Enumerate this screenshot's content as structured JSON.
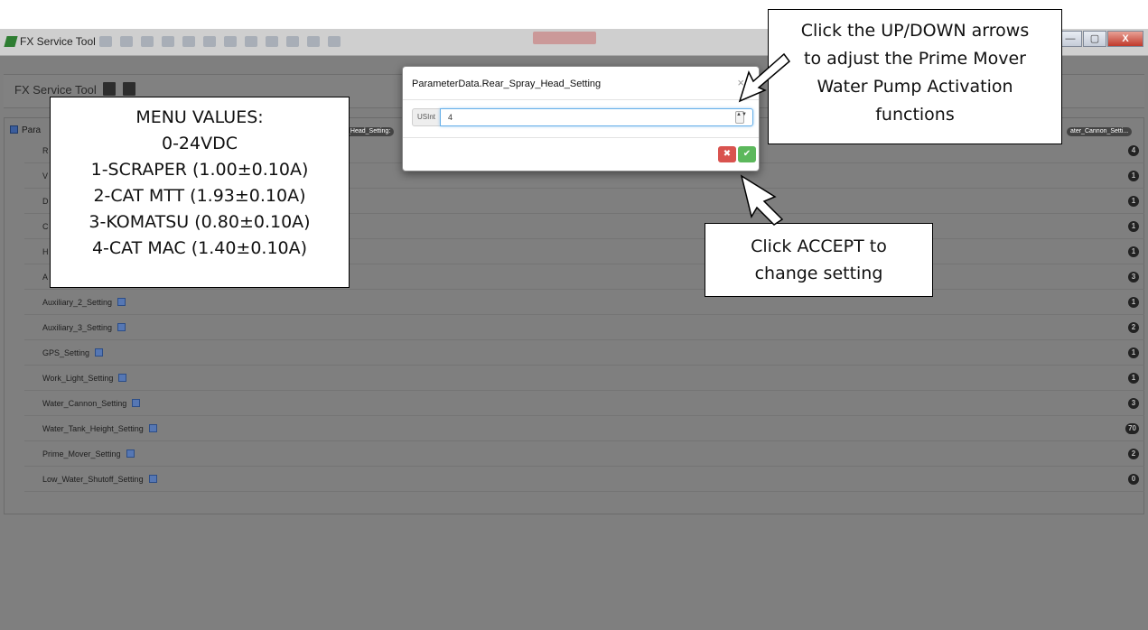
{
  "window": {
    "title": "FX Service Tool",
    "controls": {
      "minimize": "—",
      "maximize": "▢",
      "close": "X"
    }
  },
  "header": {
    "title": "FX Service Tool",
    "icons": [
      "save-icon",
      "export-icon"
    ]
  },
  "panel": {
    "group_label": "Para",
    "chips": [
      "_Head_Setting:",
      "ater_Cannon_Setti..."
    ],
    "rows": [
      {
        "label": "R",
        "value": "4",
        "editable": false
      },
      {
        "label": "V",
        "value": "1",
        "editable": false
      },
      {
        "label": "D",
        "value": "1",
        "editable": false
      },
      {
        "label": "C",
        "value": "1",
        "editable": false
      },
      {
        "label": "H",
        "value": "1",
        "editable": false
      },
      {
        "label": "A",
        "value": "3",
        "editable": false
      },
      {
        "label": "Auxiliary_2_Setting",
        "value": "1",
        "editable": true
      },
      {
        "label": "Auxiliary_3_Setting",
        "value": "2",
        "editable": true
      },
      {
        "label": "GPS_Setting",
        "value": "1",
        "editable": true
      },
      {
        "label": "Work_Light_Setting",
        "value": "1",
        "editable": true
      },
      {
        "label": "Water_Cannon_Setting",
        "value": "3",
        "editable": true
      },
      {
        "label": "Water_Tank_Height_Setting",
        "value": "70",
        "editable": true
      },
      {
        "label": "Prime_Mover_Setting",
        "value": "2",
        "editable": true
      },
      {
        "label": "Low_Water_Shutoff_Setting",
        "value": "0",
        "editable": true
      }
    ]
  },
  "modal": {
    "title": "ParameterData.Rear_Spray_Head_Setting",
    "close": "×",
    "type_label": "USInt",
    "value": "4",
    "spinner": "▲▼",
    "cancel_glyph": "✖",
    "accept_glyph": "✔",
    "cancel_color": "#d9534f",
    "accept_color": "#5cb85c"
  },
  "callouts": {
    "menu_values": [
      "MENU VALUES:",
      "0-24VDC",
      "1-SCRAPER (1.00±0.10A)",
      "2-CAT MTT (1.93±0.10A)",
      "3-KOMATSU (0.80±0.10A)",
      "4-CAT MAC (1.40±0.10A)"
    ],
    "updown": [
      "Click the UP/DOWN arrows",
      "to adjust the Prime Mover",
      "Water Pump Activation",
      "functions"
    ],
    "accept": [
      "Click ACCEPT to",
      "change setting"
    ]
  }
}
